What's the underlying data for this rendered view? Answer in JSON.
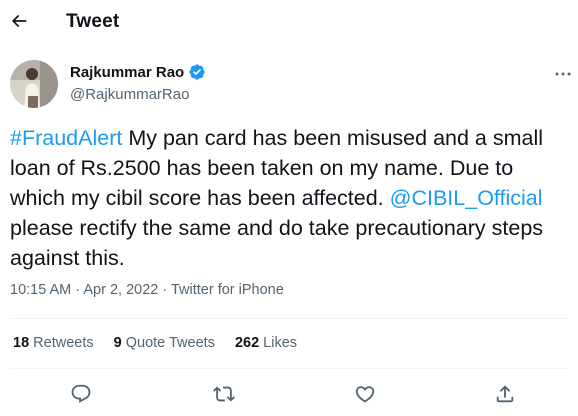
{
  "header": {
    "title": "Tweet"
  },
  "author": {
    "name": "Rajkummar Rao",
    "handle": "@RajkummarRao"
  },
  "tweet": {
    "hashtag": "#FraudAlert",
    "text_part1": " My pan card has been misused and a small loan of Rs.2500 has been taken on my name. Due to which my cibil score has been affected. ",
    "mention": "@CIBIL_Official",
    "text_part2": " please rectify the same and do take precautionary steps against this."
  },
  "meta": {
    "time": "10:15 AM",
    "sep1": " · ",
    "date": "Apr 2, 2022",
    "sep2": " · ",
    "source": "Twitter for iPhone"
  },
  "stats": {
    "retweets_count": "18",
    "retweets_label": "Retweets",
    "quotes_count": "9",
    "quotes_label": "Quote Tweets",
    "likes_count": "262",
    "likes_label": "Likes"
  },
  "colors": {
    "accent": "#1d9bf0",
    "text": "#0f1419",
    "secondary": "#536471",
    "divider": "#eff3f4"
  },
  "icons": [
    "back-arrow-icon",
    "verified-badge-icon",
    "more-icon",
    "reply-icon",
    "retweet-icon",
    "like-icon",
    "share-icon"
  ]
}
